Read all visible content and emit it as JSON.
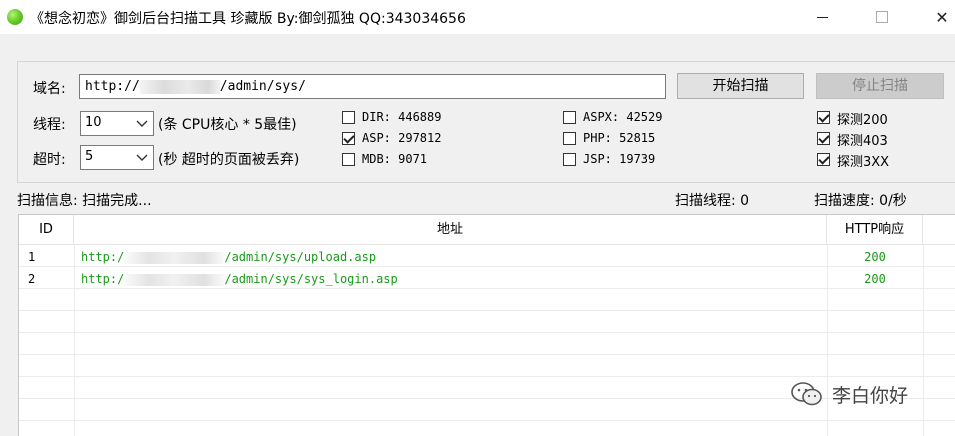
{
  "window": {
    "title": "《想念初恋》御剑后台扫描工具 珍藏版 By:御剑孤独 QQ:343034656",
    "controls": {
      "minimize": "—",
      "maximize": "☐",
      "close": "✕"
    }
  },
  "form": {
    "domain_label": "域名:",
    "domain_prefix": "http://",
    "domain_suffix": "/admin/sys/",
    "threads_label": "线程:",
    "threads_value": "10",
    "threads_hint": "(条 CPU核心 * 5最佳)",
    "timeout_label": "超时:",
    "timeout_value": "5",
    "timeout_hint": "(秒 超时的页面被丢弃)",
    "start_button": "开始扫描",
    "stop_button": "停止扫描"
  },
  "dictionaries": [
    {
      "label": "DIR: 446889",
      "checked": false
    },
    {
      "label": "ASP: 297812",
      "checked": true
    },
    {
      "label": "MDB: 9071",
      "checked": false
    },
    {
      "label": "ASPX: 42529",
      "checked": false
    },
    {
      "label": "PHP: 52815",
      "checked": false
    },
    {
      "label": "JSP: 19739",
      "checked": false
    }
  ],
  "probes": [
    {
      "label": "探测200",
      "checked": true
    },
    {
      "label": "探测403",
      "checked": true
    },
    {
      "label": "探测3XX",
      "checked": true
    }
  ],
  "status": {
    "info": "扫描信息: 扫描完成...",
    "threads": "扫描线程: 0",
    "speed": "扫描速度: 0/秒"
  },
  "table": {
    "headers": {
      "id": "ID",
      "address": "地址",
      "http": "HTTP响应"
    },
    "rows": [
      {
        "id": "1",
        "url_prefix": "http:/",
        "url_suffix": "/admin/sys/upload.asp",
        "code": "200"
      },
      {
        "id": "2",
        "url_prefix": "http:/",
        "url_suffix": "/admin/sys/sys_login.asp",
        "code": "200"
      }
    ]
  },
  "watermark": {
    "text": "李白你好",
    "icon": "wechat-icon"
  },
  "colors": {
    "accent_green": "#1a9a1a",
    "disabled_text": "#838383"
  }
}
